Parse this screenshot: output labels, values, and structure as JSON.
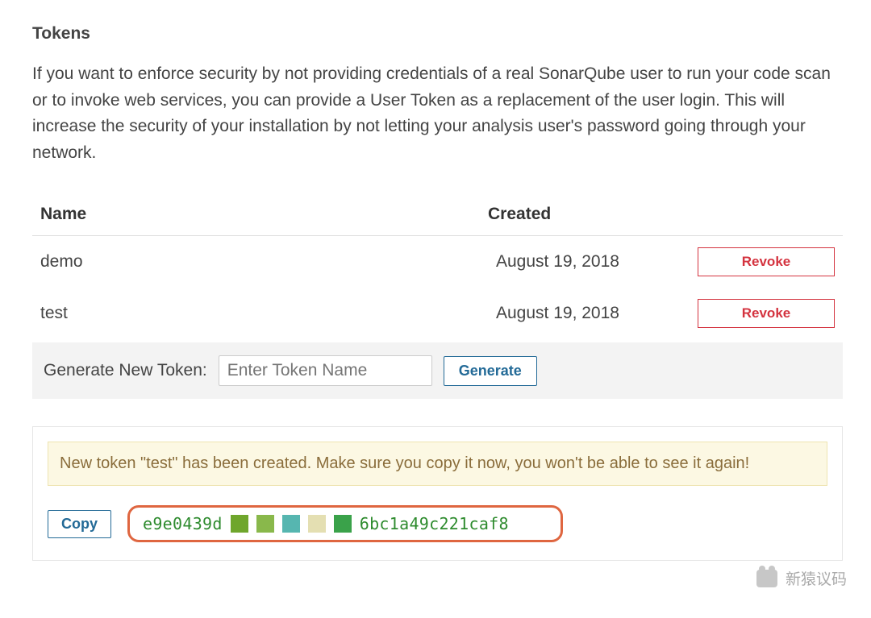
{
  "section": {
    "title": "Tokens",
    "description": "If you want to enforce security by not providing credentials of a real SonarQube user to run your code scan or to invoke web services, you can provide a User Token as a replacement of the user login. This will increase the security of your installation by not letting your analysis user's password going through your network."
  },
  "table": {
    "headers": {
      "name": "Name",
      "created": "Created"
    },
    "rows": [
      {
        "name": "demo",
        "created": "August 19, 2018",
        "revoke": "Revoke"
      },
      {
        "name": "test",
        "created": "August 19, 2018",
        "revoke": "Revoke"
      }
    ]
  },
  "generate": {
    "label": "Generate New Token:",
    "placeholder": "Enter Token Name",
    "button": "Generate"
  },
  "result": {
    "alert": "New token \"test\" has been created. Make sure you copy it now, you won't be able to see it again!",
    "copy_button": "Copy",
    "token_prefix": "e9e0439d",
    "token_suffix": "6bc1a49c221caf8"
  },
  "watermark": {
    "text": "新猿议码"
  }
}
